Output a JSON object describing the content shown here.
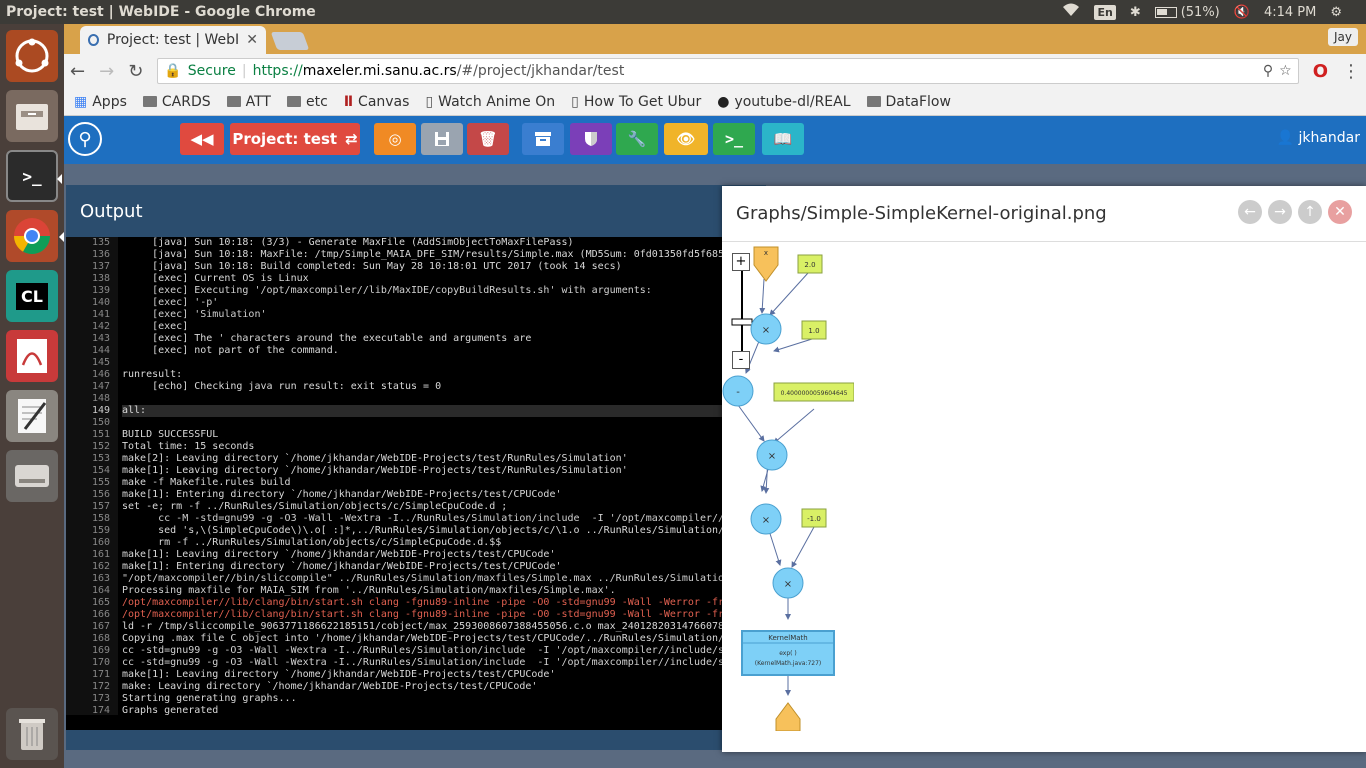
{
  "system": {
    "window_title": "Project: test | WebIDE - Google Chrome",
    "keyboard": "En",
    "battery": "(51%)",
    "battery_level": 0.51,
    "clock": "4:14 PM"
  },
  "launcher": {
    "items": [
      "ubuntu-logo",
      "files",
      "terminal",
      "chrome",
      "clion",
      "pdf-viewer",
      "text-editor",
      "disks",
      "trash"
    ],
    "clion_label": "CL"
  },
  "browser": {
    "tab_title": "Project: test | WebIDE",
    "profile": "Jay",
    "secure_label": "Secure",
    "url_scheme": "https://",
    "url_host": "maxeler.mi.sanu.ac.rs",
    "url_path": "/#/project/jkhandar/test",
    "bookmarks": [
      {
        "label": "Apps",
        "icon": "apps-grid-icon"
      },
      {
        "label": "CARDS",
        "icon": "folder-icon"
      },
      {
        "label": "ATT",
        "icon": "folder-icon"
      },
      {
        "label": "etc",
        "icon": "folder-icon"
      },
      {
        "label": "Canvas",
        "icon": "canvas-icon"
      },
      {
        "label": "Watch Anime On",
        "icon": "page-icon"
      },
      {
        "label": "How To Get Ubur",
        "icon": "page-icon"
      },
      {
        "label": "youtube-dl/REAL",
        "icon": "github-icon"
      },
      {
        "label": "DataFlow",
        "icon": "folder-icon"
      }
    ]
  },
  "webide": {
    "project_button": "Project: test",
    "user": "jkhandar",
    "colors": {
      "navbar": "#1e6fc0",
      "red": "#e04a3f",
      "orange": "#f08a24",
      "grey": "#9aa4b0",
      "dark_red": "#c44848",
      "blue": "#3a7ed0",
      "purple": "#7b3fb8",
      "green": "#2fa84f",
      "yellow": "#f0b429",
      "teal": "#2bb5c9"
    }
  },
  "output": {
    "title": "Output",
    "lines": [
      {
        "n": "135",
        "t": "     [java] Sun 10:18: (3/3) - Generate MaxFile (AddSimObjectToMaxFilePass)"
      },
      {
        "n": "136",
        "t": "     [java] Sun 10:18: MaxFile: /tmp/Simple_MAIA_DFE_SIM/results/Simple.max (MD5Sum: 0fd01350fd5f685"
      },
      {
        "n": "137",
        "t": "     [java] Sun 10:18: Build completed: Sun May 28 10:18:01 UTC 2017 (took 14 secs)"
      },
      {
        "n": "138",
        "t": "     [exec] Current OS is Linux"
      },
      {
        "n": "139",
        "t": "     [exec] Executing '/opt/maxcompiler//lib/MaxIDE/copyBuildResults.sh' with arguments:"
      },
      {
        "n": "140",
        "t": "     [exec] '-p'"
      },
      {
        "n": "141",
        "t": "     [exec] 'Simulation'"
      },
      {
        "n": "142",
        "t": "     [exec]"
      },
      {
        "n": "143",
        "t": "     [exec] The ' characters around the executable and arguments are"
      },
      {
        "n": "144",
        "t": "     [exec] not part of the command."
      },
      {
        "n": "145",
        "t": ""
      },
      {
        "n": "146",
        "t": "runresult:"
      },
      {
        "n": "147",
        "t": "     [echo] Checking java run result: exit status = 0"
      },
      {
        "n": "148",
        "t": ""
      },
      {
        "n": "149",
        "t": "all:"
      },
      {
        "n": "150",
        "t": ""
      },
      {
        "n": "151",
        "t": "BUILD SUCCESSFUL"
      },
      {
        "n": "152",
        "t": "Total time: 15 seconds"
      },
      {
        "n": "153",
        "t": "make[2]: Leaving directory `/home/jkhandar/WebIDE-Projects/test/RunRules/Simulation'"
      },
      {
        "n": "154",
        "t": "make[1]: Leaving directory `/home/jkhandar/WebIDE-Projects/test/RunRules/Simulation'"
      },
      {
        "n": "155",
        "t": "make -f Makefile.rules build"
      },
      {
        "n": "156",
        "t": "make[1]: Entering directory `/home/jkhandar/WebIDE-Projects/test/CPUCode'"
      },
      {
        "n": "157",
        "t": "set -e; rm -f ../RunRules/Simulation/objects/c/SimpleCpuCode.d ;"
      },
      {
        "n": "158",
        "t": "      cc -M -std=gnu99 -g -O3 -Wall -Wextra -I../RunRules/Simulation/include  -I '/opt/maxcompiler//"
      },
      {
        "n": "159",
        "t": "      sed 's,\\(SimpleCpuCode\\)\\.o[ :]*,../RunRules/Simulation/objects/c/\\1.o ../RunRules/Simulation/"
      },
      {
        "n": "160",
        "t": "      rm -f ../RunRules/Simulation/objects/c/SimpleCpuCode.d.$$"
      },
      {
        "n": "161",
        "t": "make[1]: Leaving directory `/home/jkhandar/WebIDE-Projects/test/CPUCode'"
      },
      {
        "n": "162",
        "t": "make[1]: Entering directory `/home/jkhandar/WebIDE-Projects/test/CPUCode'"
      },
      {
        "n": "163",
        "t": "\"/opt/maxcompiler//bin/sliccompile\" ../RunRules/Simulation/maxfiles/Simple.max ../RunRules/Simulatio"
      },
      {
        "n": "164",
        "t": "Processing maxfile for MAIA_SIM from '../RunRules/Simulation/maxfiles/Simple.max'."
      },
      {
        "n": "165",
        "t": "/opt/maxcompiler//lib/clang/bin/start.sh clang -fgnu89-inline -pipe -O0 -std=gnu99 -Wall -Werror -fr"
      },
      {
        "n": "166",
        "t": "/opt/maxcompiler//lib/clang/bin/start.sh clang -fgnu89-inline -pipe -O0 -std=gnu99 -Wall -Werror -fr"
      },
      {
        "n": "167",
        "t": "ld -r /tmp/sliccompile_9063771186622185151/cobject/max_2593008607388455056.c.o max_24012820314766078"
      },
      {
        "n": "168",
        "t": "Copying .max file C object into '/home/jkhandar/WebIDE-Projects/test/CPUCode/../RunRules/Simulation/"
      },
      {
        "n": "169",
        "t": "cc -std=gnu99 -g -O3 -Wall -Wextra -I../RunRules/Simulation/include  -I '/opt/maxcompiler//include/s"
      },
      {
        "n": "170",
        "t": "cc -std=gnu99 -g -O3 -Wall -Wextra -I../RunRules/Simulation/include  -I '/opt/maxcompiler//include/s"
      },
      {
        "n": "171",
        "t": "make[1]: Leaving directory `/home/jkhandar/WebIDE-Projects/test/CPUCode'"
      },
      {
        "n": "172",
        "t": "make: Leaving directory `/home/jkhandar/WebIDE-Projects/test/CPUCode'"
      },
      {
        "n": "173",
        "t": "Starting generating graphs..."
      },
      {
        "n": "174",
        "t": "Graphs generated"
      }
    ],
    "highlighted_line": "149"
  },
  "graphs": {
    "title": "Graphs/Simple-SimpleKernel-original.png",
    "zoom_in": "+",
    "zoom_out": "-",
    "nodes": {
      "input": "x",
      "const1": "2.0",
      "mul1": "×",
      "const2": "1.0",
      "sub": "-",
      "const3": "0.4000000059604645",
      "mul2": "×",
      "mul3": "×",
      "const4": "-1.0",
      "mul4": "×",
      "kernel_title": "KernelMath",
      "kernel_body": "exp( )",
      "kernel_src": "(KernelMath.java:727)"
    }
  }
}
